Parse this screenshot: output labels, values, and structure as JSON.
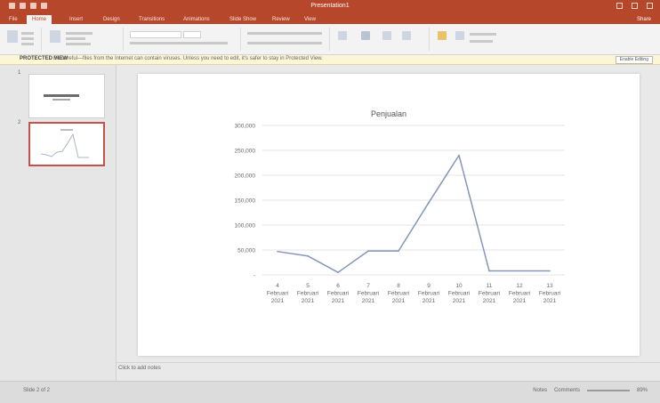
{
  "app": {
    "window_title": "Presentation1",
    "tabs": [
      "File",
      "Home",
      "Insert",
      "Design",
      "Transitions",
      "Animations",
      "Slide Show",
      "Review",
      "View"
    ],
    "active_tab_index": 1,
    "share_label": "Share"
  },
  "message_bar": {
    "label": "PROTECTED VIEW",
    "text": "Be careful—files from the Internet can contain viruses. Unless you need to edit, it's safer to stay in Protected View.",
    "button": "Enable Editing"
  },
  "thumbnails": {
    "items": [
      {
        "number": "1",
        "selected": false
      },
      {
        "number": "2",
        "selected": true
      }
    ]
  },
  "slide": {
    "chart_data": {
      "type": "line",
      "title": "Penjualan",
      "categories": [
        "4 Februari 2021",
        "5 Februari 2021",
        "6 Februari 2021",
        "7 Februari 2021",
        "8 Februari 2021",
        "9 Februari 2021",
        "10 Februari 2021",
        "11 Februari 2021",
        "12 Februari 2021",
        "13 Februari 2021"
      ],
      "category_lines": [
        [
          "4",
          "Februari",
          "2021"
        ],
        [
          "5",
          "Februari",
          "2021"
        ],
        [
          "6",
          "Februari",
          "2021"
        ],
        [
          "7",
          "Februari",
          "2021"
        ],
        [
          "8",
          "Februari",
          "2021"
        ],
        [
          "9",
          "Februari",
          "2021"
        ],
        [
          "10",
          "Februari",
          "2021"
        ],
        [
          "11",
          "Februari",
          "2021"
        ],
        [
          "12",
          "Februari",
          "2021"
        ],
        [
          "13",
          "Februari",
          "2021"
        ]
      ],
      "series": [
        {
          "values": [
            47000,
            38000,
            5000,
            48000,
            48000,
            145000,
            240000,
            8000,
            8000,
            8000
          ],
          "color": "#8397b9"
        }
      ],
      "yticks": [
        "-",
        "50,000",
        "100,000",
        "150,000",
        "200,000",
        "250,000",
        "300,000"
      ],
      "ylim": [
        0,
        300000
      ],
      "grid": true
    }
  },
  "notes": {
    "placeholder": "Click to add notes"
  },
  "status": {
    "left": "Slide 2 of 2",
    "notes_label": "Notes",
    "comments_label": "Comments",
    "zoom": "89%"
  },
  "colors": {
    "accent": "#b7472a",
    "series": "#8397b9",
    "selection": "#c6504a"
  }
}
